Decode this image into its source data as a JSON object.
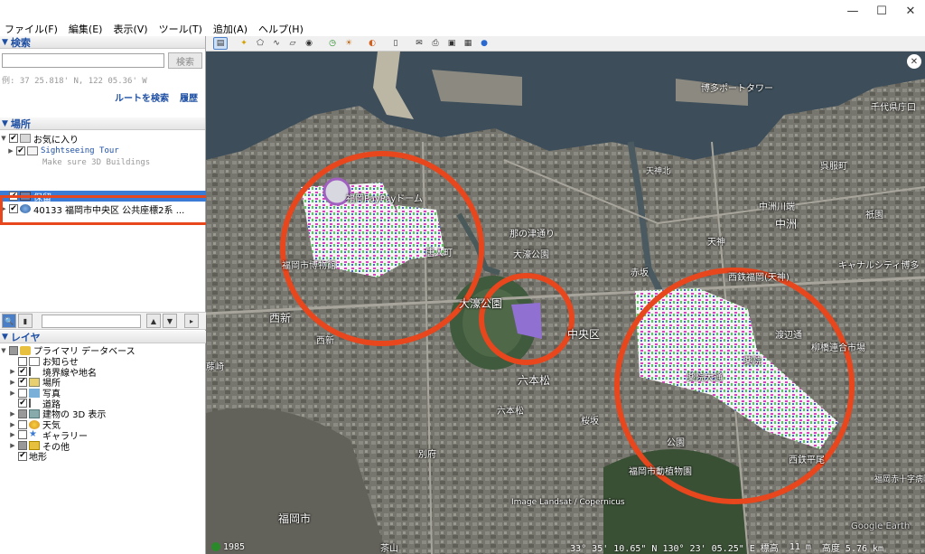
{
  "window": {
    "minimize": "—",
    "maximize": "☐",
    "close": "✕"
  },
  "menu": [
    "ファイル(F)",
    "編集(E)",
    "表示(V)",
    "ツール(T)",
    "追加(A)",
    "ヘルプ(H)"
  ],
  "search": {
    "title": "検索",
    "button": "検索",
    "hint": "例: 37 25.818' N, 122 05.36' W",
    "route_link": "ルートを検索",
    "history_link": "履歴"
  },
  "places": {
    "title": "場所",
    "items": [
      {
        "label": "お気に入り",
        "checked": true
      },
      {
        "label": "Sightseeing Tour",
        "checked": true
      },
      {
        "label": "Make sure 3D Buildings",
        "checked": false
      },
      {
        "label": "保留",
        "checked": true
      },
      {
        "label": "40133 福岡市中央区 公共座標2系 ...",
        "checked": true
      }
    ]
  },
  "layers": {
    "title": "レイヤ",
    "items": [
      {
        "label": "プライマリ データベース",
        "state": "partial"
      },
      {
        "label": "お知らせ",
        "state": "off"
      },
      {
        "label": "境界線や地名",
        "state": "on"
      },
      {
        "label": "場所",
        "state": "on"
      },
      {
        "label": "写真",
        "state": "off"
      },
      {
        "label": "道路",
        "state": "on"
      },
      {
        "label": "建物の 3D 表示",
        "state": "partial"
      },
      {
        "label": "天気",
        "state": "off"
      },
      {
        "label": "ギャラリー",
        "state": "off"
      },
      {
        "label": "その他",
        "state": "partial"
      },
      {
        "label": "地形",
        "state": "on"
      }
    ]
  },
  "map": {
    "labels": [
      "博多ポートタワー",
      "千代県庁口",
      "呉服町",
      "中洲川端",
      "祇園",
      "キャナルシティ博多",
      "天神",
      "中洲",
      "西鉄福岡(天神)",
      "渡辺通",
      "柳橋連合市場",
      "薬院",
      "薬院大通",
      "西鉄平尾",
      "福岡PayPayドーム",
      "唐人町",
      "大濠公園",
      "大濠公園",
      "赤坂",
      "中央区",
      "福岡市博物館",
      "西新",
      "西新",
      "六本松",
      "六本松",
      "桜坂",
      "別府",
      "福岡市動植物園",
      "茶山",
      "福岡市",
      "福岡赤十字病院",
      "藤崎",
      "西公園",
      "大濠公園",
      "公園",
      "高宮",
      "那の津通り",
      "天神北",
      "大手門",
      "日本庭園",
      "Google Earth"
    ],
    "attribution": "Image Landsat / Copernicus",
    "year": "1985"
  },
  "status": {
    "coords": "33° 35' 10.65\" N 130° 23' 05.25\" E 標高",
    "elevation": "11 m",
    "altitude": "高度 5.76 km"
  }
}
